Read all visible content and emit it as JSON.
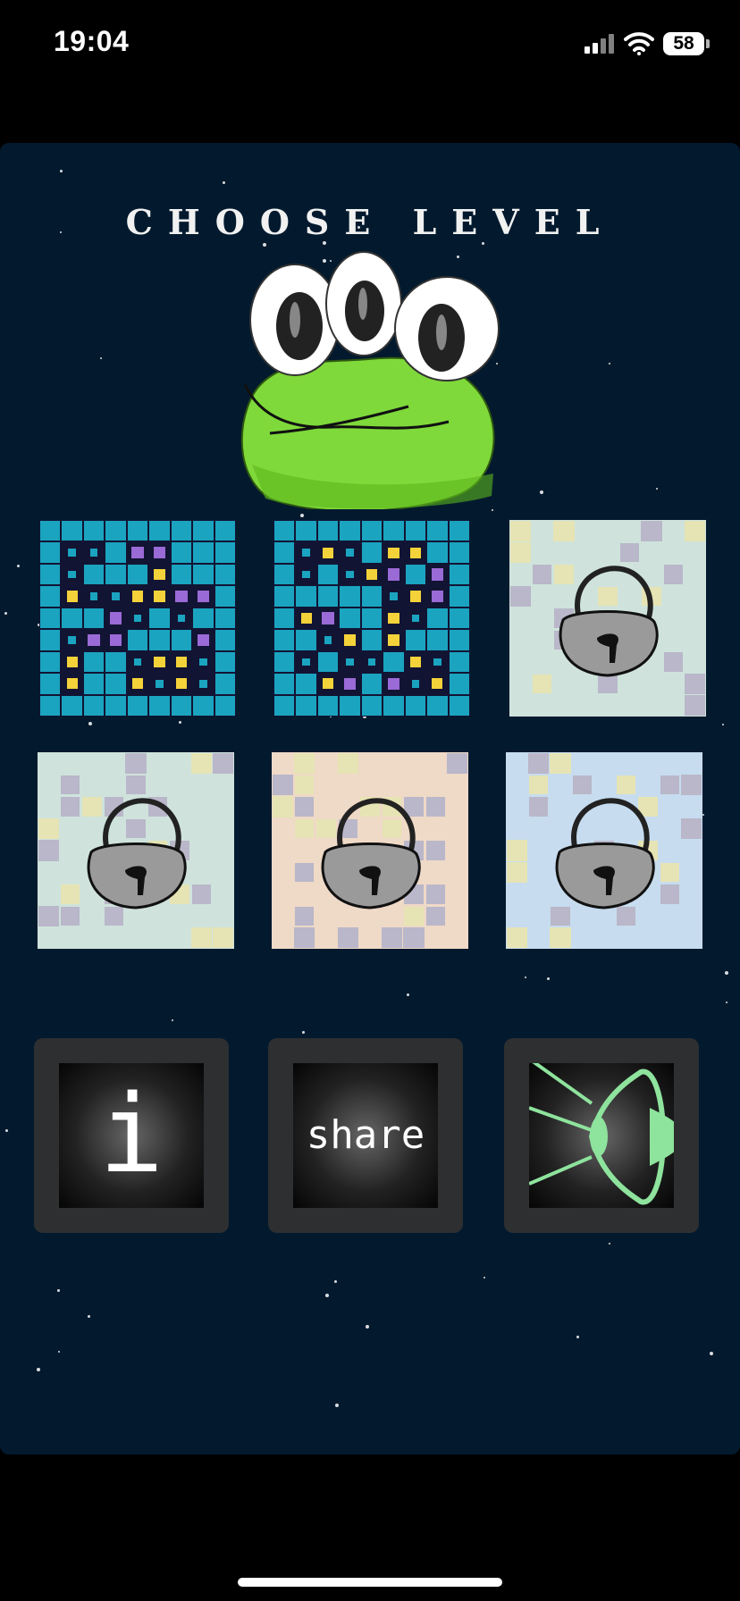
{
  "status_bar": {
    "time": "19:04",
    "battery": "58",
    "icons": [
      "signal-icon",
      "wifi-icon",
      "battery-icon"
    ]
  },
  "screen": {
    "title": "CHOOSE LEVEL"
  },
  "levels": [
    {
      "index": 1,
      "locked": false,
      "accent": "#1aa4c0"
    },
    {
      "index": 2,
      "locked": false,
      "accent": "#1aa4c0"
    },
    {
      "index": 3,
      "locked": true,
      "tint": "#cfe3dc"
    },
    {
      "index": 4,
      "locked": true,
      "tint": "#cfe3dc"
    },
    {
      "index": 5,
      "locked": true,
      "tint": "#efd9c7"
    },
    {
      "index": 6,
      "locked": true,
      "tint": "#c7dcef"
    }
  ],
  "menu": {
    "info": {
      "glyph": "i",
      "icon": "info-icon"
    },
    "share": {
      "label": "share",
      "icon": "share-icon"
    },
    "sound": {
      "icon": "speaker-icon",
      "accent": "#8ee39d"
    }
  },
  "colors": {
    "background": "#031a2e",
    "mascot_green": "#7fd93a",
    "tile_blue": "#1aa4c0"
  }
}
